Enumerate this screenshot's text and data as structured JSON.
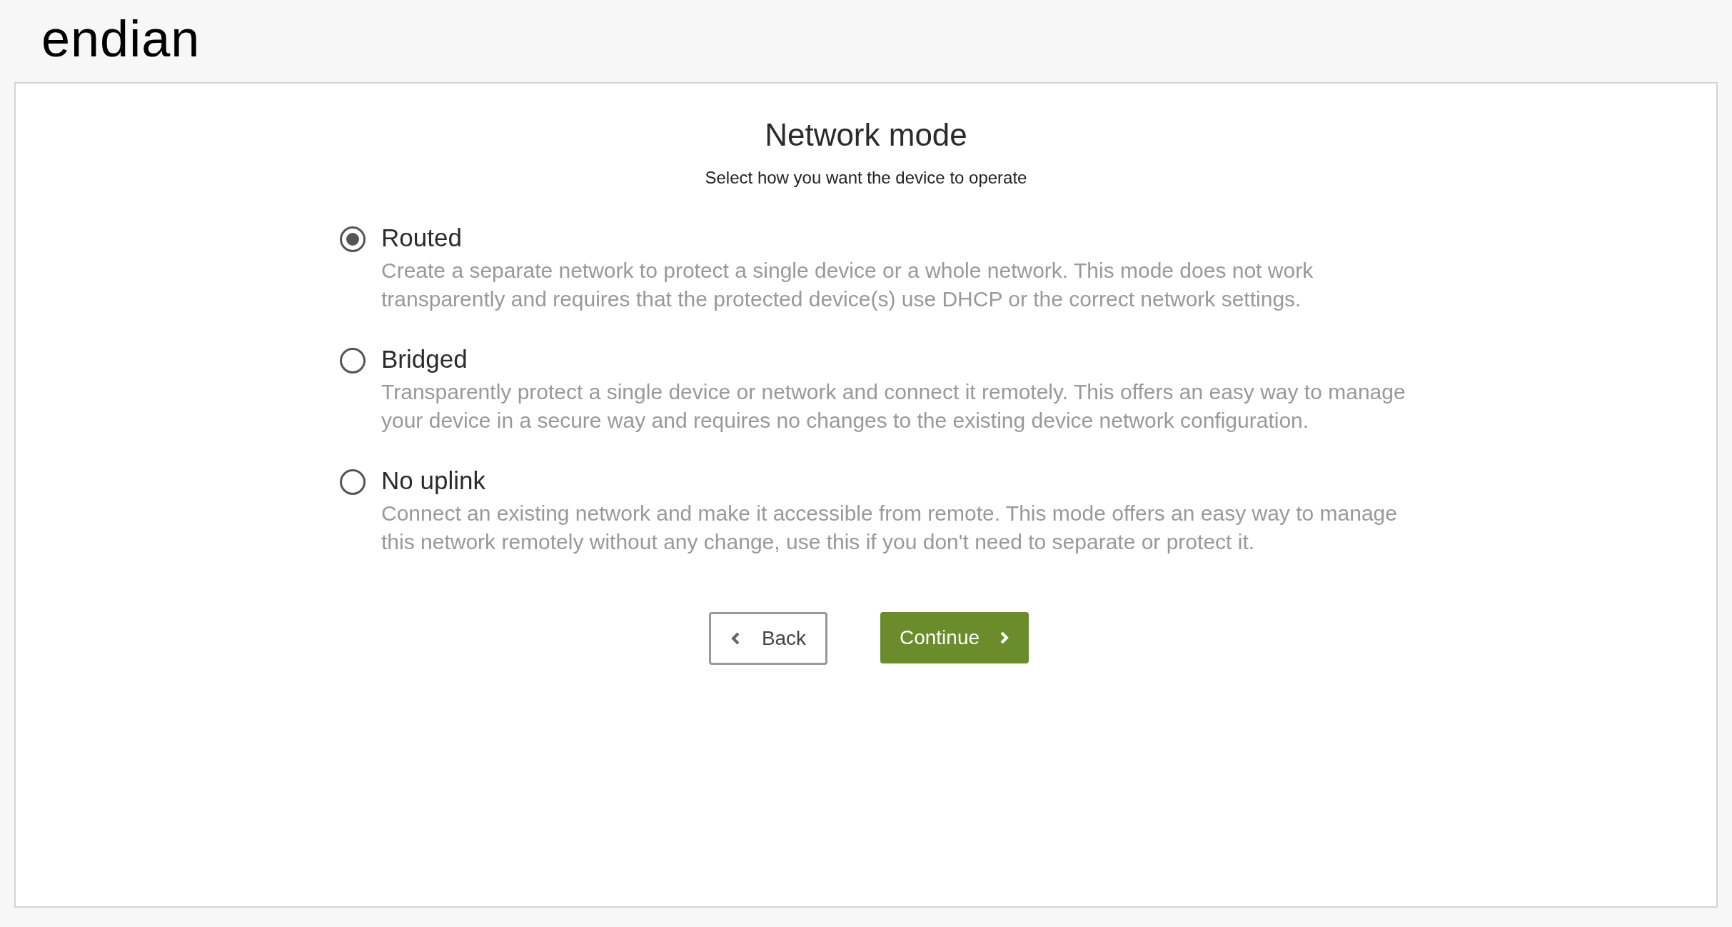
{
  "logo": "endian",
  "title": "Network mode",
  "subtitle": "Select how you want the device to operate",
  "options": [
    {
      "label": "Routed",
      "selected": true,
      "description": "Create a separate network to protect a single device or a whole network. This mode does not work transparently and requires that the protected device(s) use DHCP or the correct network settings."
    },
    {
      "label": "Bridged",
      "selected": false,
      "description": "Transparently protect a single device or network and connect it remotely. This offers an easy way to manage your device in a secure way and requires no changes to the existing device network configuration."
    },
    {
      "label": "No uplink",
      "selected": false,
      "description": "Connect an existing network and make it accessible from remote. This mode offers an easy way to manage this network remotely without any change, use this if you don't need to separate or protect it."
    }
  ],
  "buttons": [
    {
      "kind": "back",
      "label": "Back"
    },
    {
      "kind": "continue",
      "label": "Continue"
    }
  ]
}
